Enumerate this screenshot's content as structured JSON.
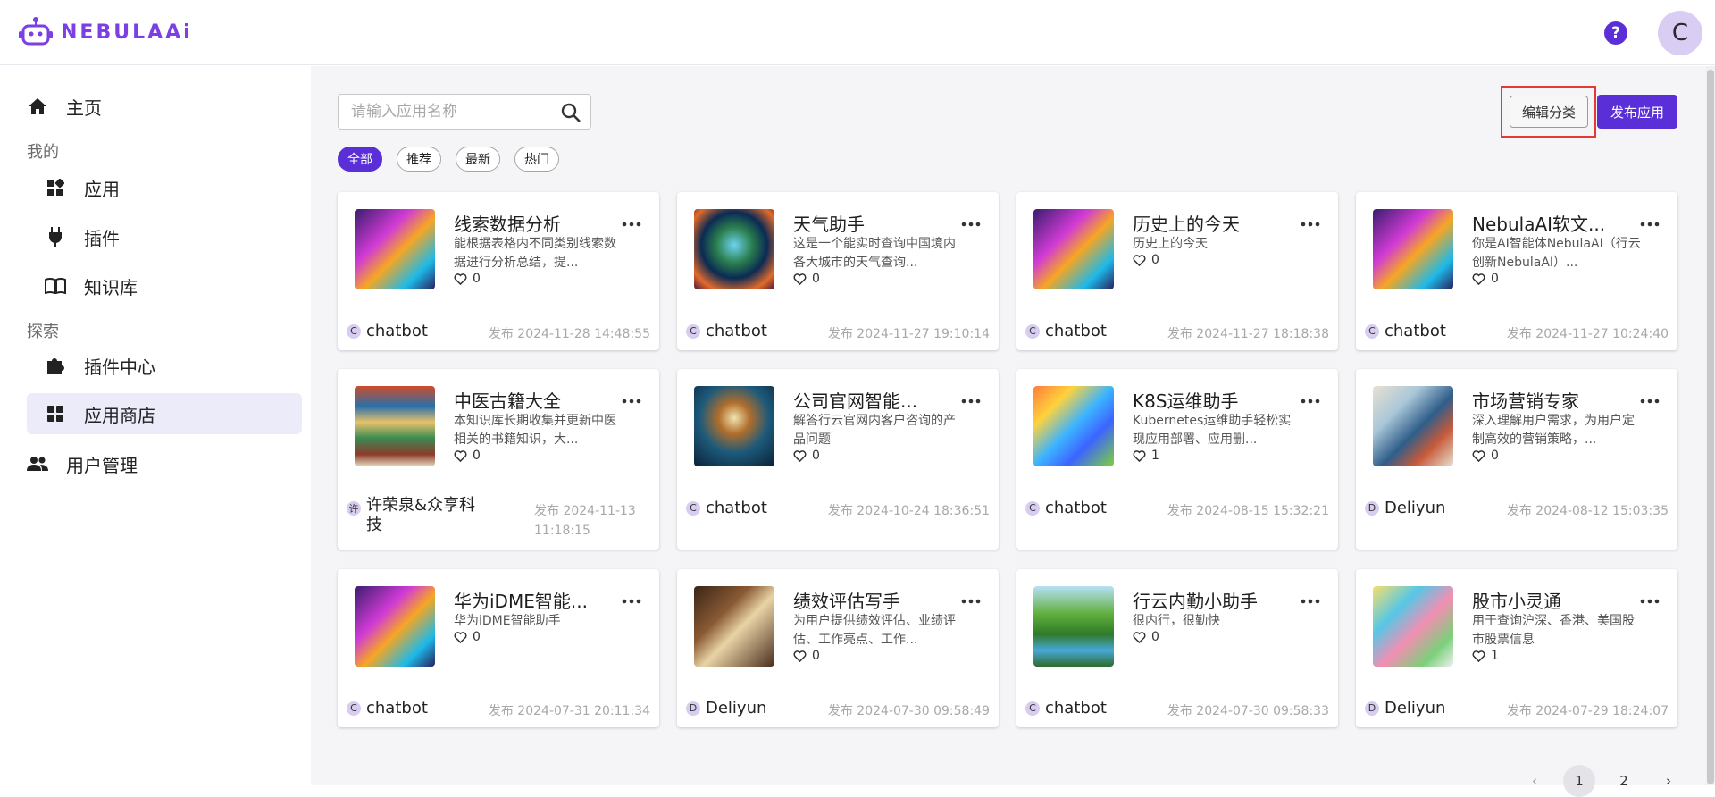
{
  "app": {
    "logo_text": "NEBULAAi",
    "avatar_letter": "C",
    "help_glyph": "?"
  },
  "sidebar": {
    "home": "主页",
    "section_mine": "我的",
    "apps": "应用",
    "plugins": "插件",
    "knowledge": "知识库",
    "section_explore": "探索",
    "plugin_center": "插件中心",
    "app_store": "应用商店",
    "user_mgmt": "用户管理"
  },
  "search": {
    "placeholder": "请输入应用名称"
  },
  "toolbar": {
    "edit_category": "编辑分类",
    "publish_app": "发布应用"
  },
  "filters": [
    "全部",
    "推荐",
    "最新",
    "热门"
  ],
  "cards": [
    {
      "title": "线索数据分析",
      "desc": "能根据表格内不同类别线索数据进行分析总结，提...",
      "likes": "0",
      "badge": "C",
      "author": "chatbot",
      "date": "发布 2024-11-28 14:48:55",
      "thumb": "robot"
    },
    {
      "title": "天气助手",
      "desc": "这是一个能实时查询中国境内各大城市的天气查询...",
      "likes": "0",
      "badge": "C",
      "author": "chatbot",
      "date": "发布 2024-11-27 19:10:14",
      "thumb": "globe"
    },
    {
      "title": "历史上的今天",
      "desc": "历史上的今天",
      "likes": "0",
      "badge": "C",
      "author": "chatbot",
      "date": "发布 2024-11-27 18:18:38",
      "thumb": "robot"
    },
    {
      "title": "NebulaAI软文...",
      "desc": "你是AI智能体NebulaAI（行云创新NebulaAI）...",
      "likes": "0",
      "badge": "C",
      "author": "chatbot",
      "date": "发布 2024-11-27 10:24:40",
      "thumb": "robot"
    },
    {
      "title": "中医古籍大全",
      "desc": "本知识库长期收集并更新中医相关的书籍知识，大...",
      "likes": "0",
      "badge": "许",
      "author": "许荣泉&众享科技",
      "date": "发布 2024-11-13 11:18:15",
      "thumb": "books"
    },
    {
      "title": "公司官网智能...",
      "desc": "解答行云官网内客户咨询的产品问题",
      "likes": "0",
      "badge": "C",
      "author": "chatbot",
      "date": "发布 2024-10-24 18:36:51",
      "thumb": "agent"
    },
    {
      "title": "K8S运维助手",
      "desc": "Kubernetes运维助手轻松实现应用部署、应用删...",
      "likes": "1",
      "badge": "C",
      "author": "chatbot",
      "date": "发布 2024-08-15 15:32:21",
      "thumb": "k8s"
    },
    {
      "title": "市场营销专家",
      "desc": "深入理解用户需求，为用户定制高效的营销策略，...",
      "likes": "0",
      "badge": "D",
      "author": "Deliyun",
      "date": "发布 2024-08-12 15:03:35",
      "thumb": "marketing"
    },
    {
      "title": "华为iDME智能...",
      "desc": "华为iDME智能助手",
      "likes": "0",
      "badge": "C",
      "author": "chatbot",
      "date": "发布 2024-07-31 20:11:34",
      "thumb": "robot"
    },
    {
      "title": "绩效评估写手",
      "desc": "为用户提供绩效评估、业绩评估、工作亮点、工作...",
      "likes": "0",
      "badge": "D",
      "author": "Deliyun",
      "date": "发布 2024-07-30 09:58:49",
      "thumb": "desk"
    },
    {
      "title": "行云内勤小助手",
      "desc": "很内行，很勤快",
      "likes": "0",
      "badge": "C",
      "author": "chatbot",
      "date": "发布 2024-07-30 09:58:33",
      "thumb": "nature"
    },
    {
      "title": "股市小灵通",
      "desc": "用于查询沪深、香港、美国股市股票信息",
      "likes": "1",
      "badge": "D",
      "author": "Deliyun",
      "date": "发布 2024-07-29 18:24:07",
      "thumb": "stocks"
    }
  ],
  "pagination": {
    "prev": "‹",
    "pages": [
      "1",
      "2"
    ],
    "next": "›"
  }
}
